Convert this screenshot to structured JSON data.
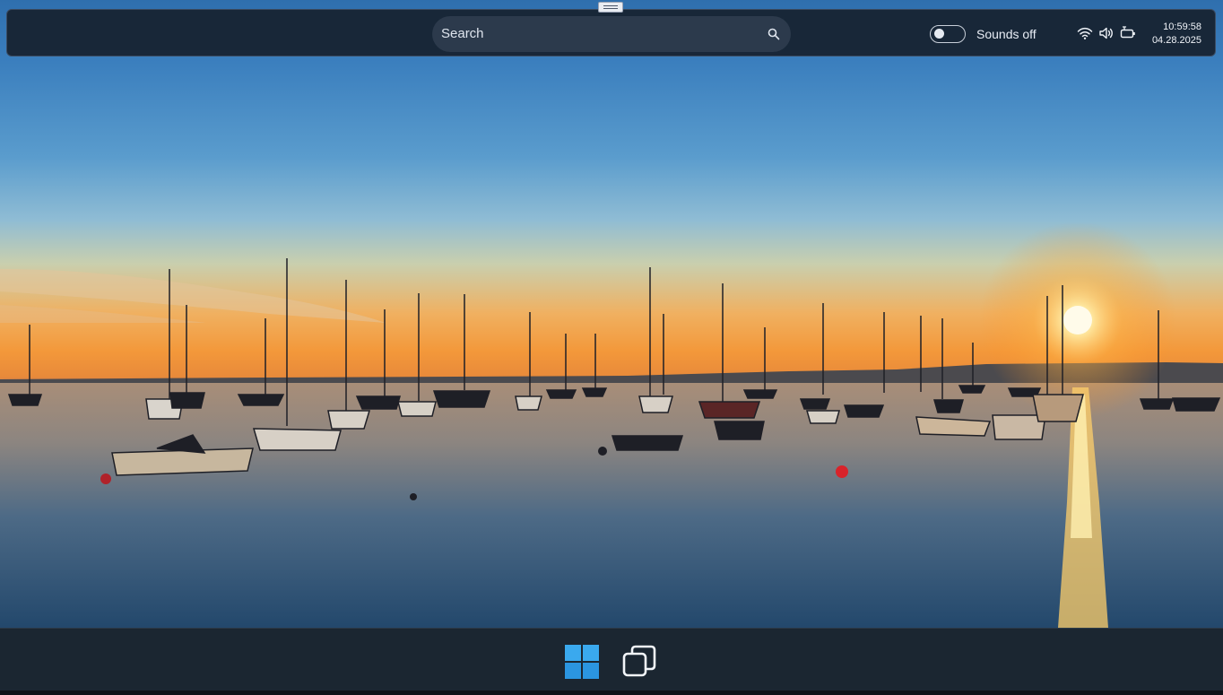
{
  "topbar": {
    "search": {
      "placeholder": "Search",
      "icon": "search-icon"
    },
    "sounds_toggle": {
      "state": "off",
      "label": "Sounds off"
    },
    "tray": {
      "icons": [
        "wifi-icon",
        "volume-icon",
        "battery-icon"
      ]
    },
    "clock": {
      "time": "10:59:58",
      "date": "04.28.2025"
    }
  },
  "taskbar": {
    "items": [
      {
        "name": "start-button",
        "icon": "windows-logo-icon"
      },
      {
        "name": "task-view-button",
        "icon": "task-view-icon"
      }
    ]
  },
  "wallpaper": {
    "subject": "sailboats at sunset",
    "sky_color": "#3b7fbe",
    "sun_color": "#fff4c8"
  }
}
